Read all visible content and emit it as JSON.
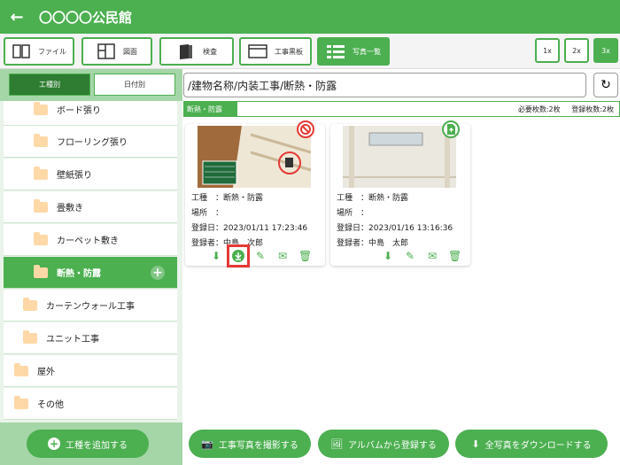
{
  "header": {
    "back_icon": "arrow-left-icon",
    "title": "〇〇〇〇公民館"
  },
  "toolbar": {
    "file": "ファイル",
    "drawing": "図面",
    "inspection": "検査",
    "blackboard": "工事黒板",
    "photo_list": "写真一覧",
    "zoom": [
      "1x",
      "2x",
      "3x"
    ],
    "zoom_selected": "3x"
  },
  "left": {
    "tab_by_work": "工種別",
    "tab_by_date": "日付別",
    "items": [
      {
        "label": "ボード張り",
        "level": 2
      },
      {
        "label": "フローリング張り",
        "level": 2
      },
      {
        "label": "壁紙張り",
        "level": 2
      },
      {
        "label": "畳敷き",
        "level": 2
      },
      {
        "label": "カーペット敷き",
        "level": 2
      },
      {
        "label": "断熱・防露",
        "level": 2,
        "selected": true
      },
      {
        "label": "カーテンウォール工事",
        "level": 1
      },
      {
        "label": "ユニット工事",
        "level": 1
      },
      {
        "label": "屋外",
        "level": 0
      },
      {
        "label": "その他",
        "level": 0
      }
    ],
    "add_work_button": "工種を追加する"
  },
  "path": "/建物名称/内装工事/断熱・防露",
  "category": {
    "name": "断熱・防露",
    "required": "必要枚数:2枚",
    "registered": "登録枚数:2枚"
  },
  "photos": [
    {
      "type_line": "工種　：断熱・防露",
      "place_line": "場所　：",
      "date_line": "登録日：2023/01/11 17:23:46",
      "user_line": "登録者：中島　次郎",
      "badge_icon": "no-entry-icon"
    },
    {
      "type_line": "工種　：断熱・防露",
      "place_line": "場所　：",
      "date_line": "登録日：2023/01/16 13:16:36",
      "user_line": "登録者：中島　太郎",
      "badge_icon": "upload-file-icon"
    }
  ],
  "footer": {
    "take_photo": "工事写真を撮影する",
    "from_album": "アルバムから登録する",
    "download_all": "全写真をダウンロードする"
  },
  "colors": {
    "primary": "#4caf50",
    "dark": "#2e7d32",
    "light": "#a5d6a7",
    "highlight": "#e53935"
  }
}
